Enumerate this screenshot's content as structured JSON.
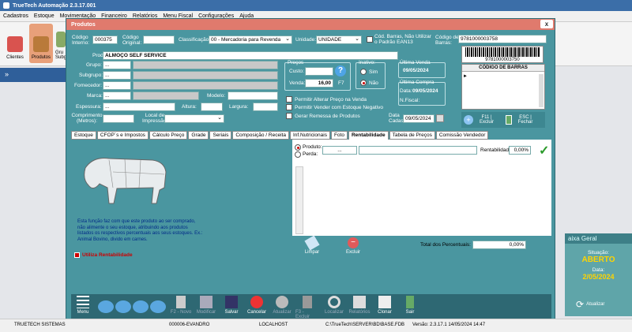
{
  "app": {
    "title": "TrueTech Automação 2.3.17.001"
  },
  "menu": [
    "Cadastros",
    "Estoque",
    "Movimentação",
    "Financeiro",
    "Relatórios",
    "Menu Fiscal",
    "Configurações",
    "Ajuda"
  ],
  "ribbon": {
    "clientes": "Clientes",
    "produtos": "Produtos",
    "grupos": "Gru Subg"
  },
  "nav": {
    "arrow": "»"
  },
  "window": {
    "title": "Produtos",
    "close": "x"
  },
  "form": {
    "codigo_interno_label": "Código Interno:",
    "codigo_interno": "000375",
    "codigo_original_label": "Código Original:",
    "codigo_original": "",
    "classificacao_label": "Classificação:",
    "classificacao": "00 - Mercadoria para Revenda",
    "unidade_label": "Unidade:",
    "unidade": "UNIDADE",
    "cod_barras_chk_label": "Cód. Barras, Não Utilizar o Padrão EAN13",
    "codigo_barras_label": "Código de Barras:",
    "codigo_barras": "9781000003758",
    "produto_label": "Produto:",
    "produto": "ALMOÇO SELF SERVICE",
    "grupo_label": "Grupo:",
    "subgrupo_label": "Subgrupo:",
    "fornecedor_label": "Fornecedor:",
    "marca_label": "Marca:",
    "modelo_label": "Modelo:",
    "espessura_label": "Espessura:",
    "altura_label": "Altura:",
    "largura_label": "Largura:",
    "comprimento_label": "Comprimento (Metros):",
    "local_impressao_label": "Local de Impressão:",
    "dots": "...",
    "precos_title": "Preços",
    "custo_label": "Custo:",
    "custo": "",
    "venda_label": "Venda:",
    "venda": "16,00",
    "f7": "F7",
    "inativo_title": "Inativo:",
    "sim": "Sim",
    "nao": "Não",
    "ultima_venda_title": "Última Venda",
    "ultima_venda": "09/05/2024",
    "ultima_compra_title": "Última Compra",
    "data_label": "Data:",
    "ultima_compra_data": "09/05/2024",
    "nfiscal_label": "N.Fiscal:",
    "data_cadastro_label": "Data Cadastro:",
    "data_cadastro": "09/05/2024",
    "chk_alterar_preco": "Permitir Alterar Preço na Venda",
    "chk_estoque_negativo": "Permitir Vender com Estoque Negativo",
    "chk_remessa": "Gerar Remessa de Produtos",
    "barcode_number": "9781000003750",
    "grid_header": "CÓDIGO DE BARRAS",
    "f11_label": "F11 | Excluir",
    "esc_label": "ESC | Fechar"
  },
  "tabs": [
    "Estoque",
    "CFOP´s e Impostos",
    "Cálculo Preço",
    "Grade",
    "Seriais",
    "Composição / Receita",
    "Inf.Nutricionais",
    "Foto",
    "Rentabilidade",
    "Tabela de Preços",
    "Comissão Vendedor"
  ],
  "rent": {
    "info": "Esta função faz com que este produto ao ser comprado, não alimente o seu estoque, atribuindo aos produtos listados os respectivos percentuais aos seus estoques. Ex.: Animal Bovino, divido em carnes.",
    "utiliza": "Utiliza Rentabilidade",
    "produto_opt": "Produto:",
    "perda_opt": "Perda:",
    "dots": "...",
    "rentabilidade_label": "Rentabilidade:",
    "rentabilidade": "0,00%",
    "limpar": "Limpar",
    "excluir": "Excluir",
    "total_label": "Total dos Percentuais:",
    "total": "0,00%"
  },
  "toolbar": {
    "menu": "Menu",
    "novo": "F2 - Novo",
    "modificar": "Modificar",
    "salvar": "Salvar",
    "cancelar": "Cancelar",
    "atualizar": "Atualizar",
    "f3excluir": "F3 - Excluir",
    "localizar": "Localizar",
    "relatorios": "Relatórios",
    "clonar": "Clonar",
    "sair": "Sair"
  },
  "side": {
    "title": "aixa Geral",
    "situacao_label": "Situação:",
    "situacao": "ABERTO",
    "data_label": "Data:",
    "data": "2/05/2024",
    "atualizar": "Atualizar"
  },
  "status": {
    "empresa": "TRUETECH SISTEMAS",
    "user": "000006-EVANDRO",
    "host": "LOCALHOST",
    "db": "C:\\TrueTech\\SERVER\\BD\\BASE.FDB",
    "versao": "Versão: 2.3.17.1  14/05/2024 14:47"
  },
  "colors": {
    "teal": "#4a96a0",
    "title": "#e07a6d",
    "accent": "#c00"
  }
}
